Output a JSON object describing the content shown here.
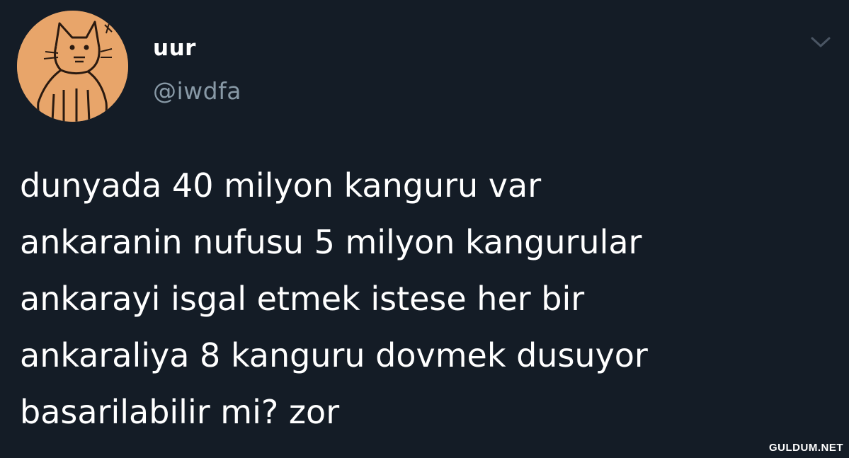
{
  "tweet": {
    "author": {
      "display_name": "uur",
      "handle": "@iwdfa",
      "avatar_icon": "cat-drawing-avatar"
    },
    "menu_icon": "chevron-down-icon",
    "text": "dunyada 40 milyon kanguru var\nankaranin nufusu 5 milyon kangurular\nankarayi isgal etmek istese her bir\nankaraliya 8 kanguru dovmek dusuyor\nbasarilabilir mi? zor"
  },
  "watermark": "GULDUM.NET",
  "colors": {
    "background": "#141c26",
    "text": "#ffffff",
    "handle": "#8899a6",
    "avatar_bg": "#e8a56a"
  }
}
